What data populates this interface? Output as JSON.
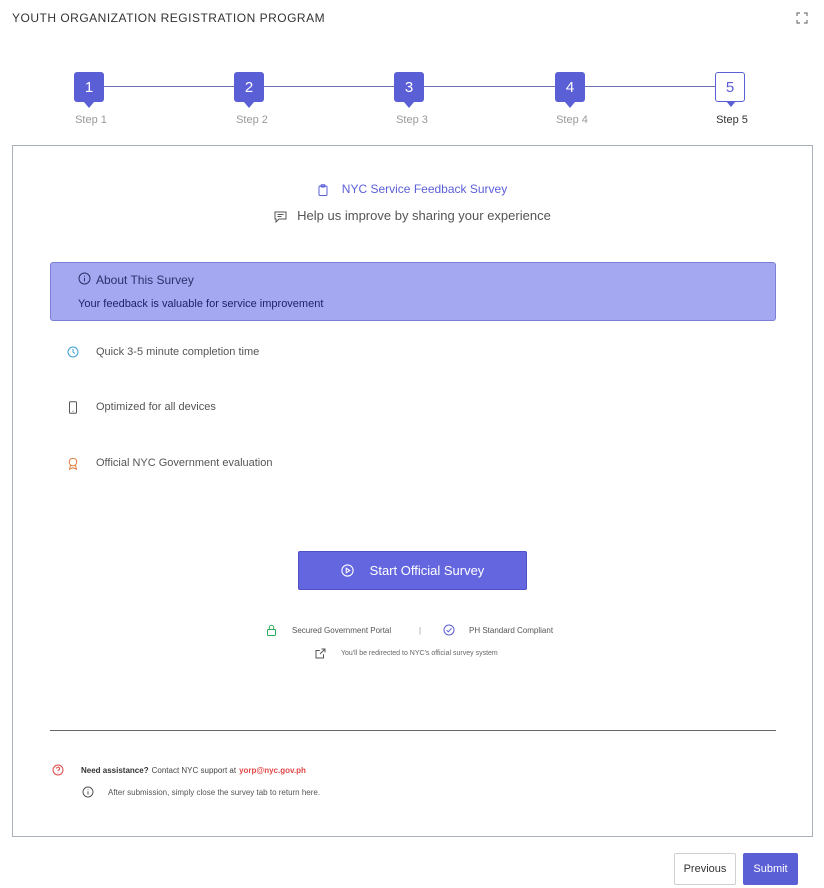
{
  "header": {
    "title": "YOUTH ORGANIZATION REGISTRATION PROGRAM",
    "expand_icon": "expand-icon"
  },
  "stepper": {
    "steps": [
      {
        "number": "1",
        "label": "Step 1",
        "state": "completed"
      },
      {
        "number": "2",
        "label": "Step 2",
        "state": "completed"
      },
      {
        "number": "3",
        "label": "Step 3",
        "state": "completed"
      },
      {
        "number": "4",
        "label": "Step 4",
        "state": "completed"
      },
      {
        "number": "5",
        "label": "Step 5",
        "state": "current"
      }
    ]
  },
  "survey": {
    "title": "NYC Service Feedback Survey",
    "title_icon": "clipboard-icon",
    "subtitle": "Help us improve by sharing your experience",
    "subtitle_icon": "message-icon"
  },
  "about": {
    "title": "About This Survey",
    "icon": "info-icon",
    "text": "Your feedback is valuable for service improvement"
  },
  "features": [
    {
      "text": "Quick 3-5 minute completion time",
      "icon": "clock-icon"
    },
    {
      "text": "Optimized for all devices",
      "icon": "mobile-icon"
    },
    {
      "text": "Official NYC Government evaluation",
      "icon": "award-icon"
    }
  ],
  "start_button": {
    "label": "Start Official Survey",
    "icon": "play-circle-icon"
  },
  "security": {
    "portal": "Secured Government Portal",
    "separator": "|",
    "compliant": "PH Standard Compliant",
    "redirect": "You'll be redirected to NYC's official survey system"
  },
  "help": {
    "lead": "Need assistance?",
    "text": "Contact NYC support at",
    "email": "yorp@nyc.gov.ph",
    "note": "After submission, simply close the survey tab to return here."
  },
  "footer": {
    "previous_label": "Previous",
    "submit_label": "Submit"
  },
  "colors": {
    "accent": "#5b5fd6",
    "about_bg": "#a4a8f0",
    "email": "#e04848",
    "lock": "#2eaa5a",
    "clock": "#3aa0d8",
    "award": "#e07b3a"
  }
}
